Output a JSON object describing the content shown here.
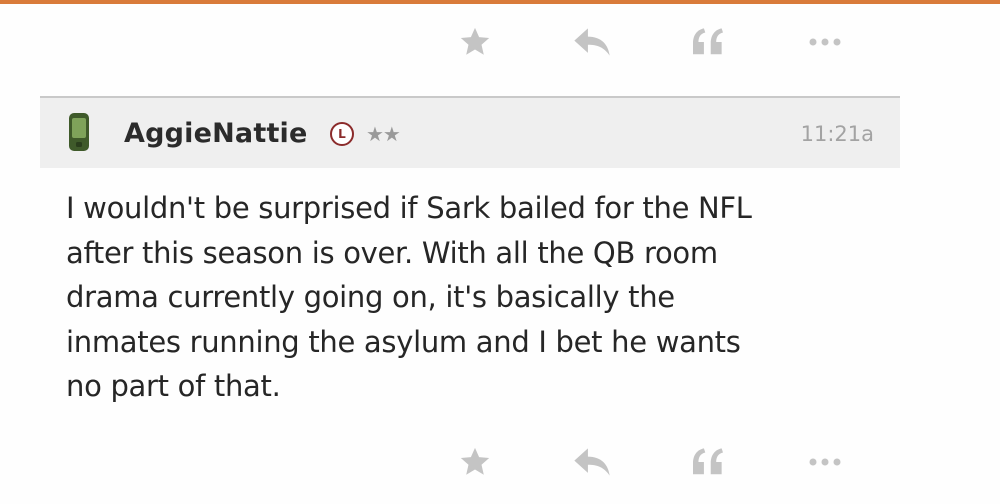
{
  "post": {
    "username": "AggieNattie",
    "badge": "L",
    "rating_stars": "★★",
    "timestamp": "11:21a",
    "body_lines": [
      "I wouldn't be surprised if Sark bailed for the NFL",
      "after this season is over. With all the QB room",
      "drama currently going on, it's basically the",
      "inmates running the asylum and I bet he wants",
      "no part of that."
    ]
  },
  "actions": {
    "like_icon": "star-icon",
    "reply_icon": "reply-arrow-icon",
    "quote_icon": "quote-icon",
    "more_icon": "more-dots-icon"
  },
  "colors": {
    "accent": "#d97b3a",
    "header_bg": "#efefef",
    "icon_gray": "#c4c4c4",
    "badge": "#8b2b2b",
    "device_green": "#3f5a2a"
  }
}
